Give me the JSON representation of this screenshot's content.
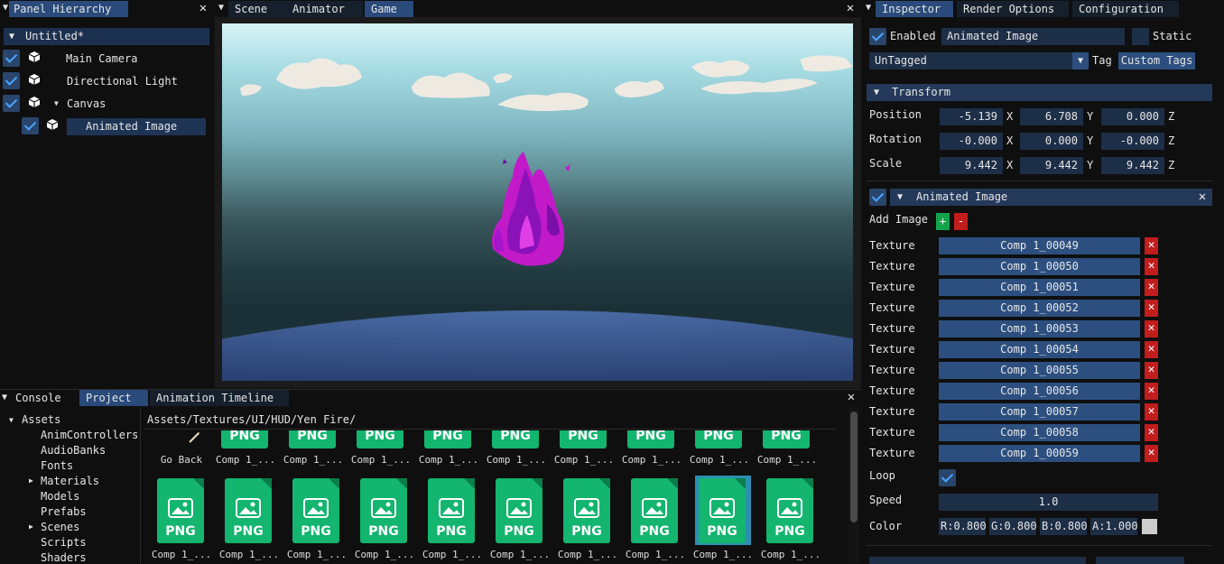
{
  "hierarchy": {
    "tab": "Panel Hierarchy",
    "scene_name": "Untitled*",
    "items": [
      "Main Camera",
      "Directional Light",
      "Canvas",
      "Animated Image"
    ]
  },
  "viewport": {
    "tabs": [
      "Scene",
      "Animator",
      "Game"
    ],
    "active_tab": "Game"
  },
  "inspector": {
    "tabs": [
      "Inspector",
      "Render Options",
      "Configuration"
    ],
    "enabled_label": "Enabled",
    "object_name": "Animated Image",
    "static_label": "Static",
    "tag_value": "UnTagged",
    "tag_label": "Tag",
    "custom_tags_button": "Custom Tags",
    "transform": {
      "title": "Transform",
      "rows": [
        {
          "label": "Position",
          "x": "-5.139",
          "y": "6.708",
          "z": "0.000"
        },
        {
          "label": "Rotation",
          "x": "-0.000",
          "y": "0.000",
          "z": "-0.000"
        },
        {
          "label": "Scale",
          "x": "9.442",
          "y": "9.442",
          "z": "9.442"
        }
      ],
      "axis_x": "X",
      "axis_y": "Y",
      "axis_z": "Z"
    },
    "animated_image": {
      "title": "Animated Image",
      "add_image_label": "Add Image",
      "add_button": "+",
      "remove_button": "-",
      "texture_label": "Texture",
      "textures": [
        "Comp 1_00049",
        "Comp 1_00050",
        "Comp 1_00051",
        "Comp 1_00052",
        "Comp 1_00053",
        "Comp 1_00054",
        "Comp 1_00055",
        "Comp 1_00056",
        "Comp 1_00057",
        "Comp 1_00058",
        "Comp 1_00059"
      ],
      "loop_label": "Loop",
      "speed_label": "Speed",
      "speed_value": "1.0",
      "color_label": "Color",
      "color": {
        "r": "R:0.800",
        "g": "G:0.800",
        "b": "B:0.800",
        "a": "A:1.000"
      }
    }
  },
  "bottom": {
    "tabs": [
      "Console",
      "Project",
      "Animation Timeline"
    ],
    "active_tab": "Project",
    "tree_root": "Assets",
    "tree": [
      "AnimControllers",
      "AudioBanks",
      "Fonts",
      "Materials",
      "Models",
      "Prefabs",
      "Scenes",
      "Scripts",
      "Shaders"
    ],
    "path": "Assets/Textures/UI/HUD/Yen Fire/",
    "go_back": "Go Back",
    "file_badge": "PNG",
    "file_caption": "Comp 1_..."
  },
  "colors": {
    "accent": "#294a7a",
    "png_green": "#13b56f",
    "delete_red": "#c21d1d"
  }
}
